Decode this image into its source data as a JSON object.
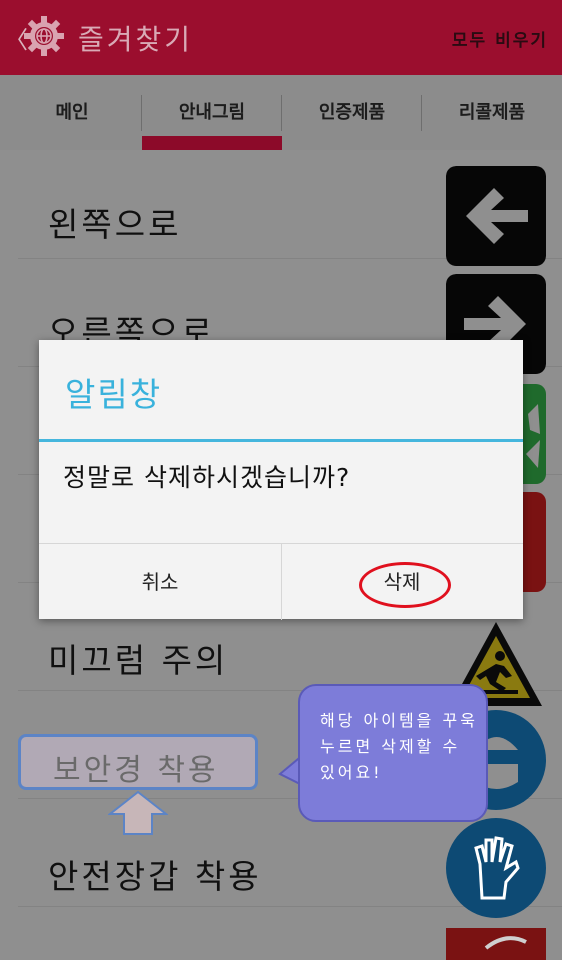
{
  "header": {
    "back_glyph": "〈",
    "app_icon": "gear-globe-icon",
    "title": "즐겨찾기",
    "clear_all": "모두 비우기"
  },
  "tabs": [
    {
      "label": "메인"
    },
    {
      "label": "안내그림",
      "selected": true
    },
    {
      "label": "인증제품"
    },
    {
      "label": "리콜제품"
    }
  ],
  "list": {
    "items": [
      {
        "label": "왼쪽으로",
        "icon": "arrow-left-sign-icon"
      },
      {
        "label": "오른쪽으로",
        "icon": "arrow-right-sign-icon"
      },
      {
        "label": "",
        "icon": "green-exit-sign-icon"
      },
      {
        "label": "",
        "icon": "red-sign-icon"
      },
      {
        "label": "미끄럼 주의",
        "icon": "slippery-warning-sign-icon"
      },
      {
        "label": "보안경 착용",
        "icon": "safety-goggles-sign-icon"
      },
      {
        "label": "안전장갑 착용",
        "icon": "safety-gloves-sign-icon"
      }
    ]
  },
  "dialog": {
    "title": "알림창",
    "message": "정말로 삭제하시겠습니까?",
    "cancel": "취소",
    "delete": "삭제"
  },
  "hint": {
    "highlighted_label": "보안경 착용",
    "bubble": "해당 아이템을 꾸욱 누르면 삭제할 수 있어요!"
  },
  "colors": {
    "header": "#9b0e2e",
    "accent_underline": "#8c0a29",
    "dialog_title": "#39b2dc",
    "highlight_circle": "#e0101e"
  }
}
